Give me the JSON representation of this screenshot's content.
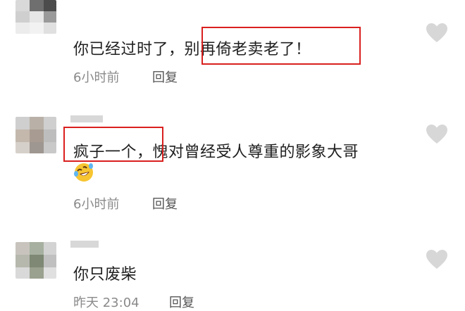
{
  "comments": [
    {
      "text": "你已经过时了，别再倚老卖老了！",
      "time": "6小时前",
      "reply_label": "回复"
    },
    {
      "text": "疯子一个，愧对曾经受人尊重的影象大哥",
      "time": "6小时前",
      "reply_label": "回复",
      "emoji": "rolling-on-floor-laughing-emoji"
    },
    {
      "text": "你只废柴",
      "time": "昨天 23:04",
      "reply_label": "回复"
    }
  ],
  "colors": {
    "highlight": "#d9201f",
    "text": "#1f1f1f",
    "meta": "#8a8a8a",
    "heart": "#d7d7d7"
  }
}
